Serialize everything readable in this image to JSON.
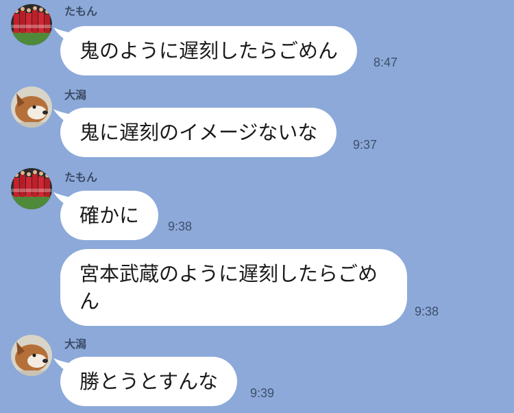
{
  "chat": {
    "messages": [
      {
        "sender": "たもん",
        "text": "鬼のように遅刻したらごめん",
        "time": "8:47"
      },
      {
        "sender": "大潟",
        "text": "鬼に遅刻のイメージないな",
        "time": "9:37"
      },
      {
        "sender": "たもん",
        "text": "確かに",
        "time": "9:38"
      },
      {
        "sender": "",
        "text": "宮本武蔵のように遅刻したらごめん",
        "time": "9:38"
      },
      {
        "sender": "大潟",
        "text": "勝とうとすんな",
        "time": "9:39"
      }
    ]
  },
  "colors": {
    "background": "#8ca9d9",
    "bubble": "#ffffff",
    "text": "#1a1a1a",
    "meta_text": "#3e4f6b"
  },
  "icons": {
    "avatar_tamon": "soccer-team-photo-avatar",
    "avatar_ogata": "dog-photo-avatar"
  }
}
